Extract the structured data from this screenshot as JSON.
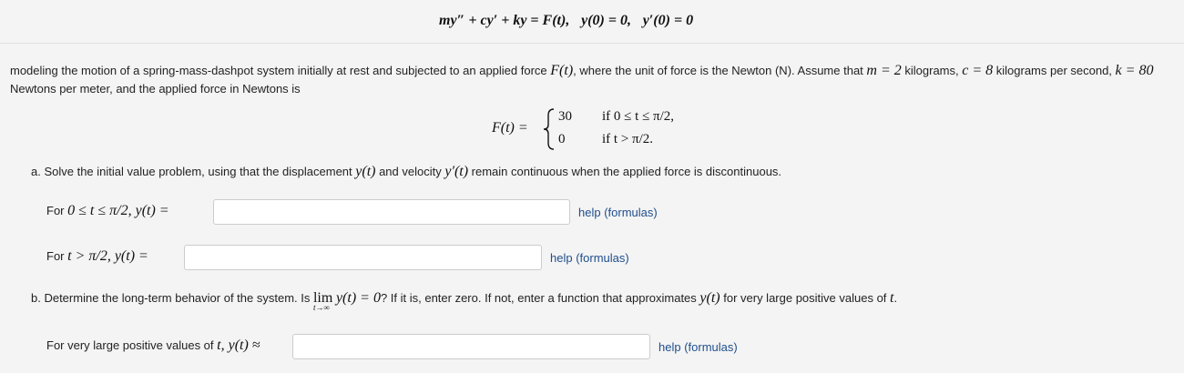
{
  "equation": {
    "lhs": "my″ + cy′ + ky = F(t),",
    "ic1": "y(0) = 0,",
    "ic2": "y′(0) = 0"
  },
  "intro": {
    "t1": "modeling the motion of a spring-mass-dashpot system initially at rest and subjected to an applied force ",
    "f": "F(t)",
    "t2": ", where the unit of force is the Newton (N). Assume that ",
    "m": "m = 2",
    "t3": " kilograms, ",
    "c": "c = 8",
    "t4": " kilograms per second, ",
    "k": "k = 80",
    "t5": " Newtons per meter, and the applied force in Newtons is"
  },
  "force": {
    "lhs": "F(t) =",
    "case1_value": "30",
    "case1_cond": "if 0 ≤ t ≤ π/2,",
    "case2_value": "0",
    "case2_cond": "if t > π/2."
  },
  "part_a": {
    "t1": "a. Solve the initial value problem, using that the displacement ",
    "y": "y(t)",
    "t2": " and velocity ",
    "yp": "y′(t)",
    "t3": " remain continuous when the applied force is discontinuous."
  },
  "row1": {
    "prefix": "For ",
    "math": "0 ≤ t ≤ π/2,  y(t) =",
    "input_value": "",
    "help": "help (formulas)"
  },
  "row2": {
    "prefix": "For ",
    "math": "t > π/2,  y(t) =",
    "input_value": "",
    "help": "help (formulas)"
  },
  "part_b": {
    "t1": "b. Determine the long-term behavior of the system. Is ",
    "lim": "lim",
    "lim_sub": "t→∞",
    "expr": "y(t) = 0",
    "t2": "? If it is, enter zero. If not, enter a function that approximates ",
    "y": "y(t)",
    "t3": " for very large positive values of ",
    "t": "t",
    "t4": "."
  },
  "row3": {
    "prefix": "For very large positive values of ",
    "t": "t",
    "math": ", y(t) ≈",
    "input_value": "",
    "help": "help (formulas)"
  }
}
